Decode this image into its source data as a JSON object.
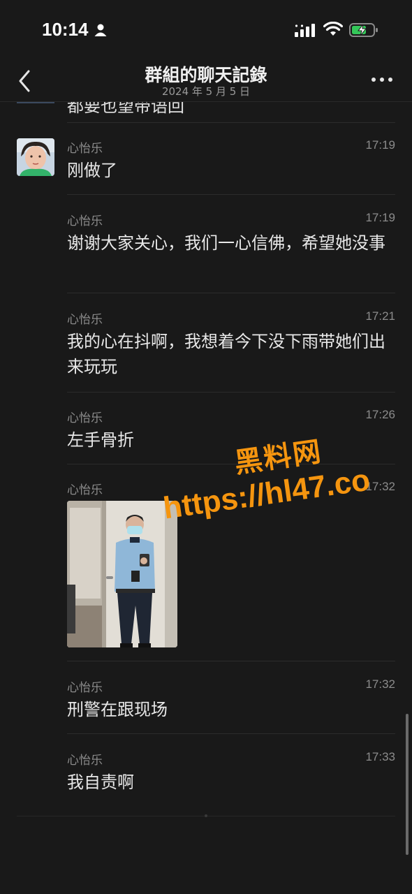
{
  "status_bar": {
    "time": "10:14"
  },
  "nav": {
    "title": "群組的聊天記錄",
    "date": "2024 年 5 月 5 日"
  },
  "partial_top_text": "都要也望带语回",
  "messages": [
    {
      "sender": "心怡乐",
      "time": "17:19",
      "text": "刚做了",
      "show_avatar": true
    },
    {
      "sender": "心怡乐",
      "time": "17:19",
      "text": "谢谢大家关心，我们一心信佛，希望她没事"
    },
    {
      "sender": "心怡乐",
      "time": "17:21",
      "text": "我的心在抖啊，我想着今下没下雨带她们出来玩玩"
    },
    {
      "sender": "心怡乐",
      "time": "17:26",
      "text": "左手骨折"
    },
    {
      "sender": "心怡乐",
      "time": "17:32",
      "type": "image"
    },
    {
      "sender": "心怡乐",
      "time": "17:32",
      "text": "刑警在跟现场"
    },
    {
      "sender": "心怡乐",
      "time": "17:33",
      "text": "我自责啊"
    }
  ],
  "watermark": {
    "name": "黑料网",
    "url": "https://hl47.co"
  },
  "colors": {
    "background": "#191919",
    "watermark": "#f5950f",
    "battery_fill": "#34c759"
  }
}
